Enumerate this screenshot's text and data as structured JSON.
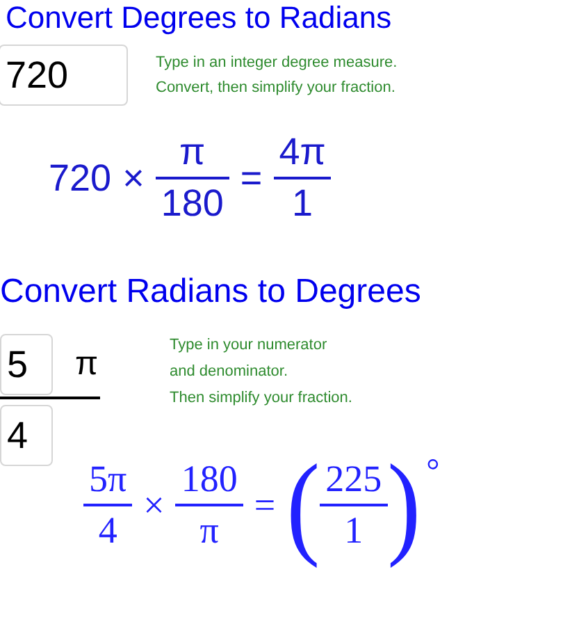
{
  "degrees_to_radians": {
    "title": "Convert Degrees to Radians",
    "degree_input": {
      "value": "720"
    },
    "instructions": [
      "Type in an integer degree measure.",
      "Convert, then simplify your fraction."
    ],
    "formula": {
      "degrees": "720",
      "times": "×",
      "factor": {
        "numerator": "π",
        "denominator": "180"
      },
      "equals": "=",
      "result": {
        "numerator": "4π",
        "denominator": "1"
      }
    }
  },
  "radians_to_degrees": {
    "title": "Convert Radians to Degrees",
    "numerator_input": {
      "value": "5"
    },
    "pi_label": "π",
    "denominator_input": {
      "value": "4"
    },
    "instructions": [
      "Type in your numerator",
      "and denominator.",
      "Then simplify your fraction."
    ],
    "formula": {
      "angle": {
        "numerator": "5π",
        "denominator": "4"
      },
      "times": "×",
      "factor": {
        "numerator": "180",
        "denominator": "π"
      },
      "equals": "=",
      "open_paren": "(",
      "result": {
        "numerator": "225",
        "denominator": "1"
      },
      "close_paren": ")",
      "degree_sign": "°"
    }
  }
}
